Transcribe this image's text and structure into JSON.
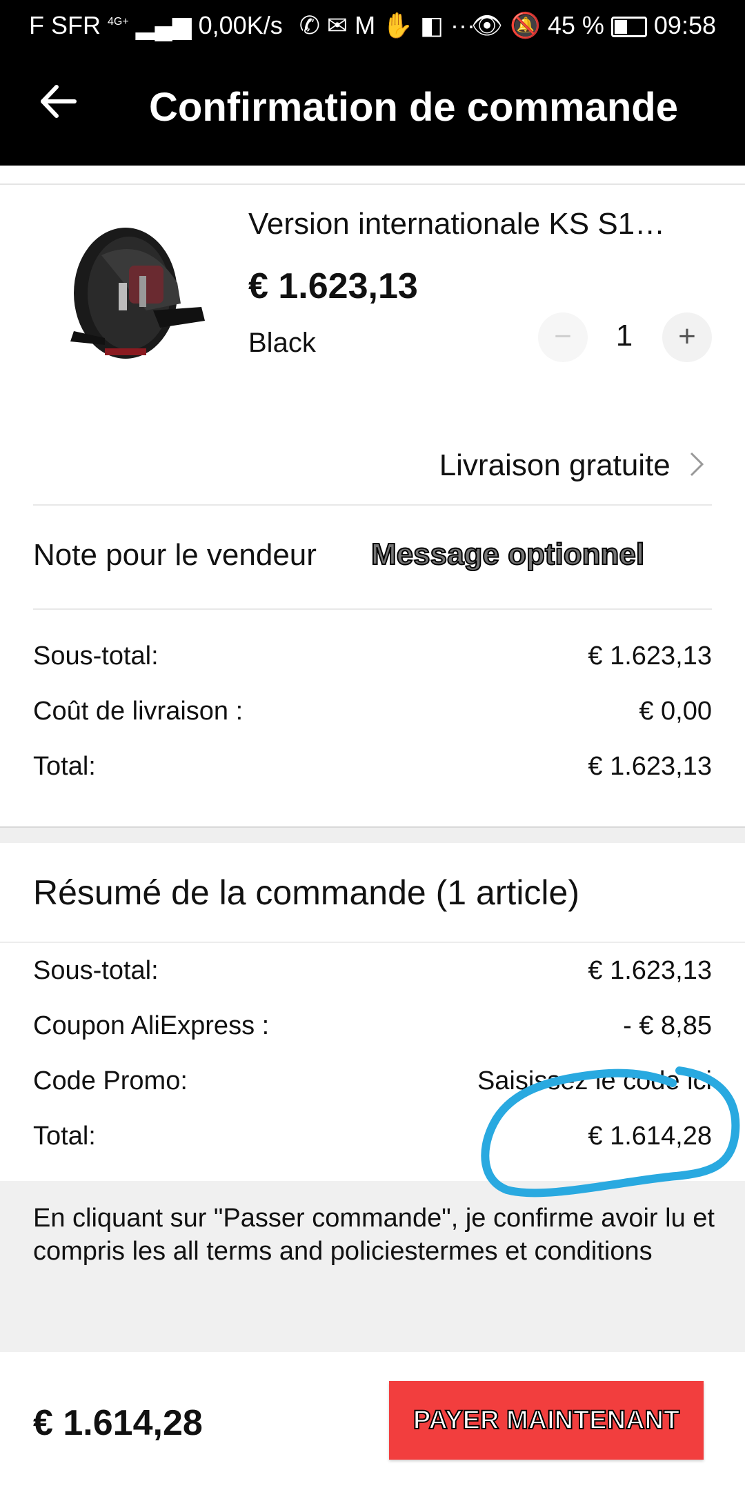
{
  "status_bar": {
    "carrier": "F SFR",
    "network": "4G+",
    "speed": "0,00K/s",
    "battery": "45 %",
    "time": "09:58"
  },
  "header": {
    "back_icon": "arrow-left-icon",
    "title": "Confirmation de commande"
  },
  "product": {
    "name": "Version internationale KS S1…",
    "price": "€ 1.623,13",
    "color": "Black",
    "quantity": "1",
    "minus_label": "−",
    "plus_label": "+"
  },
  "shipping": {
    "label": "Livraison gratuite"
  },
  "note": {
    "label": "Note pour le vendeur",
    "placeholder": "Message optionnel"
  },
  "store_summary": {
    "rows": [
      {
        "label": "Sous-total:",
        "value": "€ 1.623,13"
      },
      {
        "label": "Coût de livraison :",
        "value": "€ 0,00"
      },
      {
        "label": "Total:",
        "value": "€ 1.623,13"
      }
    ]
  },
  "order_summary": {
    "title": "Résumé de la commande (1 article)",
    "rows": [
      {
        "label": "Sous-total:",
        "value": "€ 1.623,13"
      },
      {
        "label": "Coupon AliExpress :",
        "value": "- € 8,85"
      },
      {
        "label": "Code Promo:",
        "value": "Saisissez le code ici"
      },
      {
        "label": "Total:",
        "value": "€ 1.614,28"
      }
    ]
  },
  "terms": {
    "text": "En cliquant sur \"Passer commande\", je confirme avoir lu et compris les all terms and policiestermes et conditions"
  },
  "footer": {
    "total": "€ 1.614,28",
    "pay_label": "PAYER MAINTENANT"
  },
  "colors": {
    "header_bg": "#000000",
    "pay_button": "#f23e3e",
    "annotation": "#29a9e0"
  }
}
